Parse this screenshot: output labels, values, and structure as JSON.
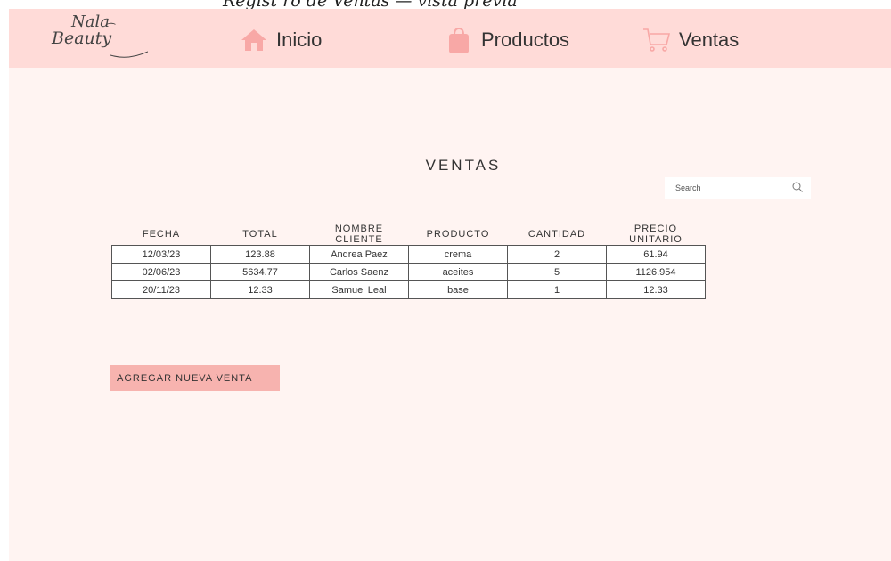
{
  "partial_caption": "Regist ro de Ventas — vista previa",
  "logo": {
    "line1": "Nala",
    "line2": "Beauty"
  },
  "nav": [
    {
      "label": "Inicio",
      "icon": "home-icon"
    },
    {
      "label": "Productos",
      "icon": "shopping-bag-icon"
    },
    {
      "label": "Ventas",
      "icon": "cart-icon"
    }
  ],
  "title": "VENTAS",
  "search": {
    "placeholder": "Search",
    "value": ""
  },
  "table": {
    "headers": [
      "FECHA",
      "TOTAL",
      "NOMBRE CLIENTE",
      "PRODUCTO",
      "CANTIDAD",
      "PRECIO UNITARIO"
    ],
    "rows": [
      [
        "12/03/23",
        "123.88",
        "Andrea Paez",
        "crema",
        "2",
        "61.94"
      ],
      [
        "02/06/23",
        "5634.77",
        "Carlos Saenz",
        "aceites",
        "5",
        "1126.954"
      ],
      [
        "20/11/23",
        "12.33",
        "Samuel Leal",
        "base",
        "1",
        "12.33"
      ]
    ]
  },
  "add_button": "AGREGAR NUEVA VENTA",
  "colors": {
    "navbar": "#ffdbd8",
    "background": "#fff4f2",
    "accent": "#f7b3af",
    "icon_pink": "#f8a8a6"
  }
}
